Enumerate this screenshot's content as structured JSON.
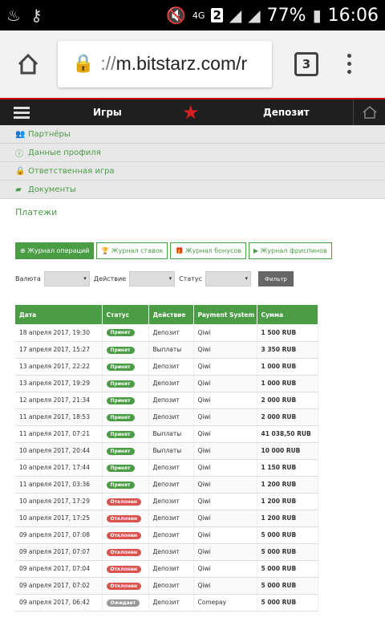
{
  "statusbar": {
    "net": "4G",
    "sim": "2",
    "battery": "77%",
    "time": "16:06"
  },
  "browser": {
    "url_scheme": "://",
    "url_host": "m.bitstarz.com/r",
    "tab_count": "3"
  },
  "sitenav": {
    "games": "Игры",
    "deposit": "Депозит"
  },
  "account_menu": [
    {
      "label": "Партнёры",
      "icon": "people-icon"
    },
    {
      "label": "Данные профиля",
      "icon": "info-icon"
    },
    {
      "label": "Ответственная игра",
      "icon": "lock-icon"
    },
    {
      "label": "Документы",
      "icon": "folder-icon"
    }
  ],
  "page_title": "Платежи",
  "tabs": [
    {
      "label": "Журнал операций",
      "active": true
    },
    {
      "label": "Журнал ставок",
      "active": false
    },
    {
      "label": "Журнал бонусов",
      "active": false
    },
    {
      "label": "Журнал фриспинов",
      "active": false
    }
  ],
  "filters": {
    "currency_label": "Валюта",
    "action_label": "Действие",
    "status_label": "Статус",
    "filter_button": "Фильтр"
  },
  "table": {
    "headers": [
      "Дата",
      "Статус",
      "Действие",
      "Payment System",
      "Сумма"
    ],
    "rows": [
      {
        "date": "18 апреля 2017, 19:30",
        "status": "Принят",
        "status_type": "ok",
        "action": "Депозит",
        "system": "Qiwi",
        "amount": "1 500 RUB"
      },
      {
        "date": "17 апреля 2017, 15:27",
        "status": "Принят",
        "status_type": "ok",
        "action": "Выплаты",
        "system": "Qiwi",
        "amount": "3 350 RUB"
      },
      {
        "date": "13 апреля 2017, 22:22",
        "status": "Принят",
        "status_type": "ok",
        "action": "Депозит",
        "system": "Qiwi",
        "amount": "1 000 RUB"
      },
      {
        "date": "13 апреля 2017, 19:29",
        "status": "Принят",
        "status_type": "ok",
        "action": "Депозит",
        "system": "Qiwi",
        "amount": "1 000 RUB"
      },
      {
        "date": "12 апреля 2017, 21:34",
        "status": "Принят",
        "status_type": "ok",
        "action": "Депозит",
        "system": "Qiwi",
        "amount": "2 000 RUB"
      },
      {
        "date": "11 апреля 2017, 18:53",
        "status": "Принят",
        "status_type": "ok",
        "action": "Депозит",
        "system": "Qiwi",
        "amount": "2 000 RUB"
      },
      {
        "date": "11 апреля 2017, 07:21",
        "status": "Принят",
        "status_type": "ok",
        "action": "Выплаты",
        "system": "Qiwi",
        "amount": "41 038,50 RUB"
      },
      {
        "date": "10 апреля 2017, 20:44",
        "status": "Принят",
        "status_type": "ok",
        "action": "Выплаты",
        "system": "Qiwi",
        "amount": "10 000 RUB"
      },
      {
        "date": "10 апреля 2017, 17:44",
        "status": "Принят",
        "status_type": "ok",
        "action": "Депозит",
        "system": "Qiwi",
        "amount": "1 150 RUB"
      },
      {
        "date": "11 апреля 2017, 03:36",
        "status": "Принят",
        "status_type": "ok",
        "action": "Депозит",
        "system": "Qiwi",
        "amount": "1 200 RUB"
      },
      {
        "date": "10 апреля 2017, 17:29",
        "status": "Отклонен",
        "status_type": "no",
        "action": "Депозит",
        "system": "Qiwi",
        "amount": "1 200 RUB"
      },
      {
        "date": "10 апреля 2017, 17:25",
        "status": "Отклонен",
        "status_type": "no",
        "action": "Депозит",
        "system": "Qiwi",
        "amount": "1 200 RUB"
      },
      {
        "date": "09 апреля 2017, 07:08",
        "status": "Отклонен",
        "status_type": "no",
        "action": "Депозит",
        "system": "Qiwi",
        "amount": "5 000 RUB"
      },
      {
        "date": "09 апреля 2017, 07:07",
        "status": "Отклонен",
        "status_type": "no",
        "action": "Депозит",
        "system": "Qiwi",
        "amount": "5 000 RUB"
      },
      {
        "date": "09 апреля 2017, 07:04",
        "status": "Отклонен",
        "status_type": "no",
        "action": "Депозит",
        "system": "Qiwi",
        "amount": "5 000 RUB"
      },
      {
        "date": "09 апреля 2017, 07:02",
        "status": "Отклонен",
        "status_type": "no",
        "action": "Депозит",
        "system": "Qiwi",
        "amount": "5 000 RUB"
      },
      {
        "date": "09 апреля 2017, 06:42",
        "status": "Ожидает",
        "status_type": "wait",
        "action": "Депозит",
        "system": "Comepay",
        "amount": "5 000 RUB"
      }
    ]
  },
  "colors": {
    "accent": "#4a9c45",
    "rejected": "#d9534f",
    "pending": "#999999",
    "nav_bg": "#1f1f1f",
    "star": "#d32222"
  }
}
